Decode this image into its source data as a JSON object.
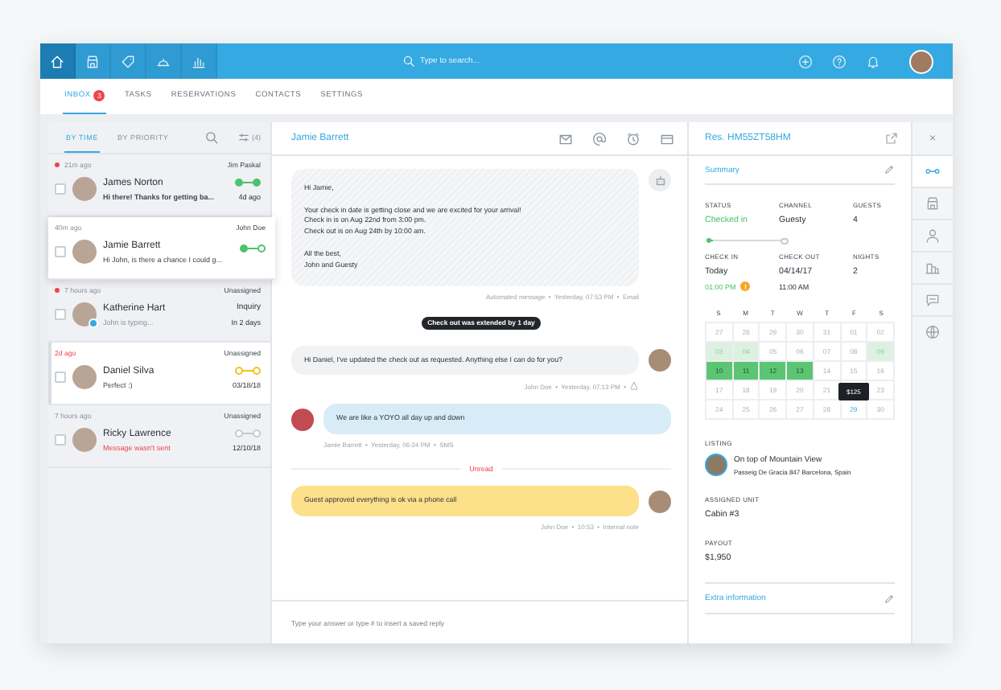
{
  "topbar": {
    "nav": [
      {
        "kind": "home",
        "selected": true
      },
      {
        "kind": "store",
        "selected": false
      },
      {
        "kind": "tag",
        "selected": false
      },
      {
        "kind": "cloche",
        "selected": false
      },
      {
        "kind": "chart",
        "selected": false
      }
    ],
    "search": {
      "placeholder": "Type to search..."
    }
  },
  "tabs": [
    {
      "label": "INBOX",
      "badge": "3",
      "selected": true
    },
    {
      "label": "TASKS",
      "selected": false
    },
    {
      "label": "RESERVATIONS",
      "selected": false
    },
    {
      "label": "CONTACTS",
      "selected": false
    },
    {
      "label": "SETTINGS",
      "selected": false
    }
  ],
  "inbox": {
    "filters": [
      {
        "label": "BY TIME",
        "selected": true
      },
      {
        "label": "BY PRIORITY",
        "selected": false
      }
    ],
    "filter_count": "(4)",
    "conversations": [
      {
        "time": "21m ago",
        "flagged": true,
        "overdue": false,
        "assignee": "Jim Paskal",
        "name": "James Norton",
        "preview": "Hi there! Thanks for getting ba...",
        "unread": true,
        "typing": false,
        "failed": false,
        "checked": false,
        "selected": false,
        "hovered": false,
        "status": {
          "kind": "track",
          "start_done": true,
          "end_done": true,
          "color": "#4cc36c"
        },
        "date": "4d ago"
      },
      {
        "time": "40m ago",
        "flagged": false,
        "overdue": false,
        "assignee": "John Doe",
        "name": "Jamie Barrett",
        "preview": "Hi John, is there a chance I could g...",
        "unread": false,
        "typing": false,
        "failed": false,
        "checked": false,
        "selected": true,
        "hovered": false,
        "status": {
          "kind": "track",
          "start_done": true,
          "end_done": false,
          "color": "#4cc36c"
        }
      },
      {
        "time": "7 hours ago",
        "flagged": true,
        "overdue": false,
        "assignee": "Unassigned",
        "name": "Katherine Hart",
        "preview": "John is typing...",
        "unread": false,
        "typing": true,
        "failed": false,
        "checked": false,
        "selected": false,
        "hovered": false,
        "status": {
          "kind": "label",
          "label": "Inquiry"
        },
        "date": "In 2 days"
      },
      {
        "time": "2d ago",
        "flagged": false,
        "overdue": true,
        "assignee": "Unassigned",
        "name": "Daniel Silva",
        "preview": "Perfect :)",
        "unread": false,
        "typing": false,
        "failed": false,
        "checked": false,
        "selected": false,
        "hovered": true,
        "status": {
          "kind": "track",
          "start_done": false,
          "end_done": false,
          "color": "#f5c21b"
        },
        "date": "03/18/18"
      },
      {
        "time": "7 hours ago",
        "flagged": false,
        "overdue": false,
        "assignee": "Unassigned",
        "name": "Ricky Lawrence",
        "preview": "Message wasn't sent",
        "unread": false,
        "typing": false,
        "failed": true,
        "checked": false,
        "selected": false,
        "hovered": false,
        "status": {
          "kind": "track",
          "start_done": false,
          "end_done": false,
          "color": "#c5cad0"
        },
        "date": "12/10/18"
      }
    ]
  },
  "chat": {
    "title": "Jamie Barrett",
    "messages": [
      {
        "kind": "automated",
        "text": "Hi Jamie,\n\nYour check in date is getting close and we are excited for your arrival!\nCheck in is on Aug 22nd from 3:00 pm.\nCheck out is on Aug 24th by 10:00 am.\n\nAll the best,\nJohn and Guesty",
        "meta": "Automated message  •  Yesterday, 07:53 PM  •  Email"
      },
      {
        "kind": "event",
        "text": "Check out was extended by 1 day"
      },
      {
        "kind": "outgoing",
        "text": "Hi Daniel, I've updated the check out as requested. Anything else I can do for you?",
        "meta": "John Doe  •  Yesterday, 07:13 PM  •"
      },
      {
        "kind": "incoming",
        "text": "We are like a YOYO all day up and down",
        "meta": "Jamie Barrett  •  Yesterday, 06:24 PM  •  SMS"
      },
      {
        "kind": "divider",
        "text": "Unread"
      },
      {
        "kind": "note",
        "text": "Guest approved everything is ok via a phone call",
        "meta": "John Doe  •  10:53  •  Internal note"
      }
    ],
    "reply": {
      "placeholder": "Type your answer or type # to insert a saved reply"
    }
  },
  "reservation": {
    "title": "Res. HM55ZT58HM",
    "summary": "Summary",
    "fields": [
      {
        "label": "STATUS",
        "value": "Checked in",
        "kind": "status"
      },
      {
        "label": "CHANNEL",
        "value": "Guesty",
        "kind": "plain"
      },
      {
        "label": "GUESTS",
        "value": "4",
        "kind": "plain"
      }
    ],
    "stay": {
      "level": 0.06
    },
    "dates": [
      {
        "label": "CHECK IN",
        "value": "Today",
        "time": "01:00 PM",
        "current": true,
        "alert": "!"
      },
      {
        "label": "CHECK OUT",
        "value": "04/14/17",
        "time": "11:00 AM",
        "current": false
      },
      {
        "label": "NIGHTS",
        "value": "2",
        "current": false
      }
    ],
    "calendar": {
      "weekdays": [
        "S",
        "M",
        "T",
        "W",
        "T",
        "F",
        "S"
      ],
      "weeks": [
        [
          {
            "day": "27",
            "kind": "plain"
          },
          {
            "day": "28",
            "kind": "plain"
          },
          {
            "day": "29",
            "kind": "plain"
          },
          {
            "day": "30",
            "kind": "plain"
          },
          {
            "day": "31",
            "kind": "plain"
          },
          {
            "day": "01",
            "kind": "plain"
          },
          {
            "day": "02",
            "kind": "plain"
          }
        ],
        [
          {
            "day": "03",
            "kind": "light"
          },
          {
            "day": "04",
            "kind": "light"
          },
          {
            "day": "05",
            "kind": "plain"
          },
          {
            "day": "06",
            "kind": "plain"
          },
          {
            "day": "07",
            "kind": "plain"
          },
          {
            "day": "08",
            "kind": "plain"
          },
          {
            "day": "09",
            "kind": "light"
          }
        ],
        [
          {
            "day": "10",
            "kind": "stay"
          },
          {
            "day": "11",
            "kind": "stay"
          },
          {
            "day": "12",
            "kind": "stay"
          },
          {
            "day": "13",
            "kind": "stay"
          },
          {
            "day": "14",
            "kind": "plain"
          },
          {
            "day": "15",
            "kind": "plain"
          },
          {
            "day": "16",
            "kind": "plain"
          }
        ],
        [
          {
            "day": "17",
            "kind": "plain"
          },
          {
            "day": "18",
            "kind": "plain"
          },
          {
            "day": "19",
            "kind": "plain"
          },
          {
            "day": "20",
            "kind": "plain"
          },
          {
            "day": "21",
            "kind": "plain"
          },
          {
            "kind": "covered"
          },
          {
            "day": "23",
            "kind": "plain"
          }
        ],
        [
          {
            "day": "24",
            "kind": "plain"
          },
          {
            "day": "25",
            "kind": "plain"
          },
          {
            "day": "26",
            "kind": "plain"
          },
          {
            "day": "27",
            "kind": "plain"
          },
          {
            "day": "28",
            "kind": "plain"
          },
          {
            "day": "29",
            "kind": "hover",
            "tooltip": "$125"
          },
          {
            "day": "30",
            "kind": "plain"
          }
        ]
      ]
    },
    "listing": {
      "label": "LISTING",
      "name": "On top of Mountain View",
      "address": "Passeig De Gracia 847 Barcelona, Spain"
    },
    "unit": {
      "label": "ASSIGNED UNIT",
      "value": "Cabin #3"
    },
    "payout": {
      "label": "PAYOUT",
      "value": "$1,950"
    },
    "extra": "Extra information"
  },
  "rail": {
    "close": "×",
    "items": [
      {
        "kind": "key",
        "selected": true
      },
      {
        "kind": "store",
        "selected": false
      },
      {
        "kind": "person",
        "selected": false
      },
      {
        "kind": "buildings",
        "selected": false
      },
      {
        "kind": "chat",
        "selected": false
      },
      {
        "kind": "globe",
        "selected": false
      }
    ]
  }
}
